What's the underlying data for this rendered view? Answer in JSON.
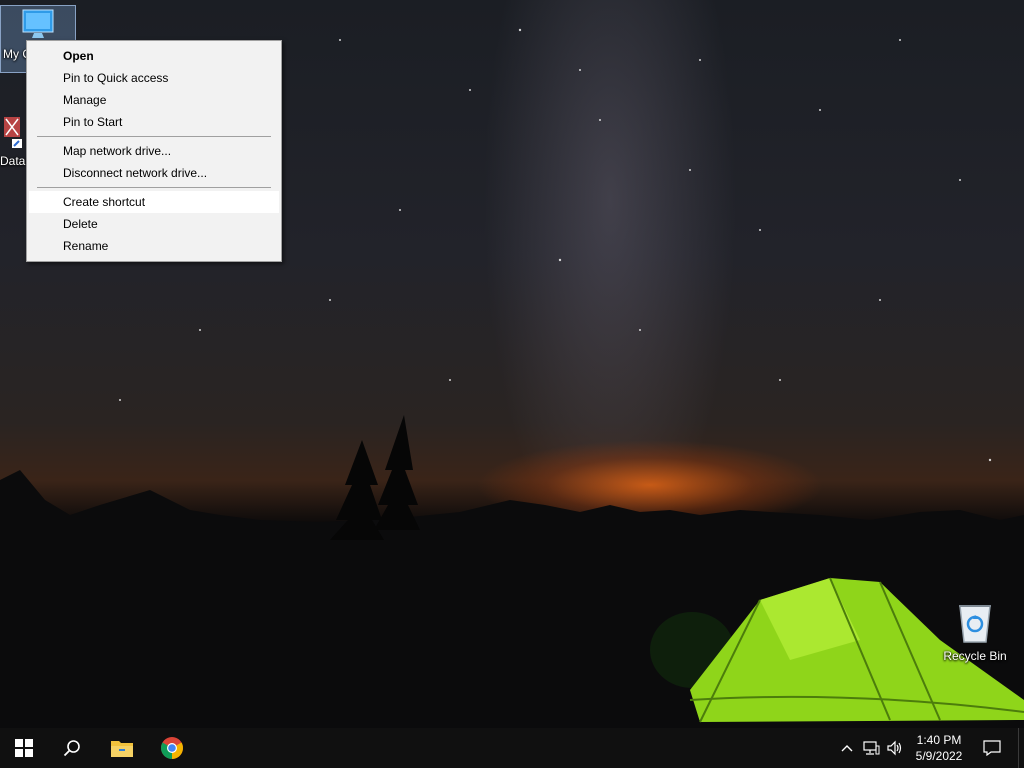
{
  "desktop": {
    "icons": [
      {
        "label": "My C"
      },
      {
        "label": "Data"
      },
      {
        "label": "Recycle Bin"
      }
    ]
  },
  "context_menu": {
    "groups": [
      [
        {
          "label": "Open",
          "bold": true
        },
        {
          "label": "Pin to Quick access"
        },
        {
          "label": "Manage"
        },
        {
          "label": "Pin to Start"
        }
      ],
      [
        {
          "label": "Map network drive..."
        },
        {
          "label": "Disconnect network drive..."
        }
      ],
      [
        {
          "label": "Create shortcut",
          "highlighted": true
        },
        {
          "label": "Delete"
        },
        {
          "label": "Rename"
        }
      ]
    ]
  },
  "taskbar": {
    "pinned": [
      {
        "icon": "windows-start-icon"
      },
      {
        "icon": "search-icon"
      },
      {
        "icon": "file-explorer-icon"
      },
      {
        "icon": "chrome-icon"
      }
    ],
    "tray": {
      "icons": [
        "chevron-up-icon",
        "network-icon",
        "volume-icon"
      ],
      "time": "1:40 PM",
      "date": "5/9/2022",
      "notification_icon": "action-center-icon"
    }
  },
  "colors": {
    "taskbar_bg": "#101010",
    "menu_bg": "#f2f2f2",
    "menu_highlight": "#ffffff",
    "tent_green": "#9be01f",
    "glow_orange": "#d66016"
  }
}
